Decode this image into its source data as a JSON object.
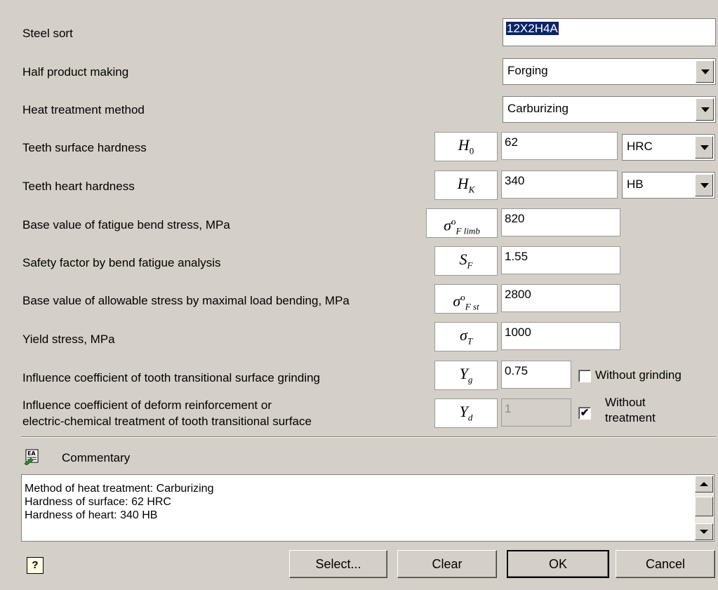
{
  "fields": {
    "steel_sort": {
      "label": "Steel sort",
      "value": "12X2H4A"
    },
    "half_product": {
      "label": "Half product making",
      "value": "Forging"
    },
    "heat_treatment": {
      "label": "Heat treatment method",
      "value": "Carburizing"
    },
    "surface_hardness": {
      "label": "Teeth surface hardness",
      "symbol": "H",
      "sub": "0",
      "value": "62",
      "unit": "HRC"
    },
    "heart_hardness": {
      "label": "Teeth heart hardness",
      "symbol": "H",
      "sub": "K",
      "value": "340",
      "unit": "HB"
    },
    "fatigue_bend": {
      "label": "Base value of fatigue bend stress, MPa",
      "symbol": "σ",
      "sup": "o",
      "sub": "F limb",
      "value": "820"
    },
    "safety_factor": {
      "label": "Safety factor by bend fatigue analysis",
      "symbol": "S",
      "sub": "F",
      "value": "1.55"
    },
    "allowable_stress": {
      "label": "Base value of allowable stress by maximal load bending, MPa",
      "symbol": "σ",
      "sup": "o",
      "sub": "F st",
      "value": "2800"
    },
    "yield_stress": {
      "label": "Yield stress, MPa",
      "symbol": "σ",
      "sub": "T",
      "value": "1000"
    },
    "grinding": {
      "label": "Influence coefficient of tooth transitional surface grinding",
      "symbol": "Y",
      "sub": "g",
      "value": "0.75",
      "checkbox_label": "Without grinding",
      "checked": false
    },
    "deform": {
      "label_line1": "Influence coefficient of deform reinforcement or",
      "label_line2": "electric-chemical treatment of tooth transitional surface",
      "symbol": "Y",
      "sub": "d",
      "value": "1",
      "checkbox_line1": "Without",
      "checkbox_line2": "treatment",
      "checked": true,
      "check_mark": "✔"
    }
  },
  "commentary": {
    "title": "Commentary",
    "lines": [
      "Method of heat treatment: Carburizing",
      "Hardness of surface: 62 HRC",
      "Hardness of heart: 340 HB"
    ]
  },
  "buttons": {
    "help": "?",
    "select": "Select...",
    "clear": "Clear",
    "ok": "OK",
    "cancel": "Cancel"
  },
  "colors": {
    "background": "#d4d0c8",
    "selection": "#0a246a"
  }
}
